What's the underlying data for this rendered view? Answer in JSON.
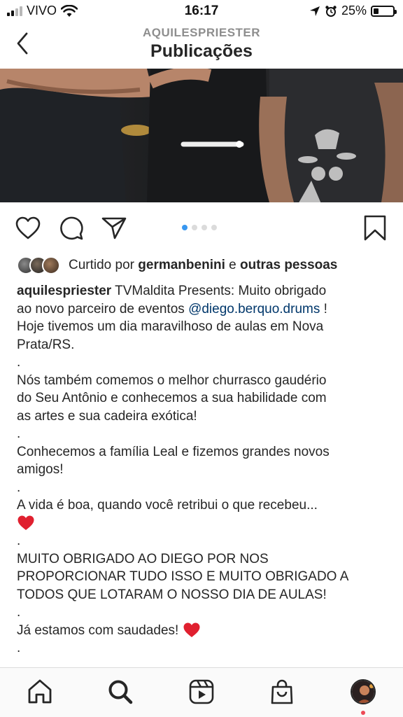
{
  "status_bar": {
    "carrier": "VIVO",
    "time": "16:17",
    "battery": "25%",
    "battery_level": 0.25
  },
  "header": {
    "subtitle": "AQUILESPRIESTER",
    "title": "Publicações"
  },
  "carousel": {
    "count": 4,
    "active_index": 0
  },
  "likes": {
    "prefix": "Curtido por ",
    "user": "germanbenini",
    "connector": " e ",
    "others": "outras pessoas"
  },
  "caption": {
    "username": "aquilespriester",
    "l1": " TVMaldita Presents: Muito obrigado",
    "l2": "ao novo parceiro de eventos ",
    "mention": "@diego.berquo.drums",
    "l2_end": " !",
    "l3": "Hoje tivemos um dia maravilhoso de aulas em Nova",
    "l4": "Prata/RS.",
    "sep1": ".",
    "l5": "Nós também comemos o melhor churrasco gaudério",
    "l6": "do Seu Antônio e conhecemos a sua habilidade com",
    "l7": "as artes e sua cadeira exótica!",
    "sep2": ".",
    "l8": "Conhecemos a família Leal e fizemos grandes novos",
    "l9": "amigos!",
    "sep3": ".",
    "l10": "A vida é boa, quando você retribui o que recebeu...",
    "sep4": ".",
    "l11": "MUITO OBRIGADO AO DIEGO POR NOS",
    "l12": "PROPORCIONAR TUDO ISSO E MUITO OBRIGADO A",
    "l13": "TODOS QUE LOTARAM O NOSSO DIA DE AULAS!",
    "sep5": ".",
    "l14": "Já estamos com saudades! ",
    "sep6": "."
  },
  "tabs": [
    "home",
    "search",
    "reels",
    "shop",
    "profile"
  ],
  "icons": {
    "back": "chevron-left-icon",
    "like": "heart-icon",
    "comment": "comment-icon",
    "share": "send-icon",
    "save": "bookmark-icon"
  },
  "colors": {
    "text": "#262626",
    "muted": "#8e8e8e",
    "mention": "#00376b",
    "active_dot": "#3897f0",
    "heart_emoji": "#e0202f",
    "notification": "#ed4956"
  }
}
